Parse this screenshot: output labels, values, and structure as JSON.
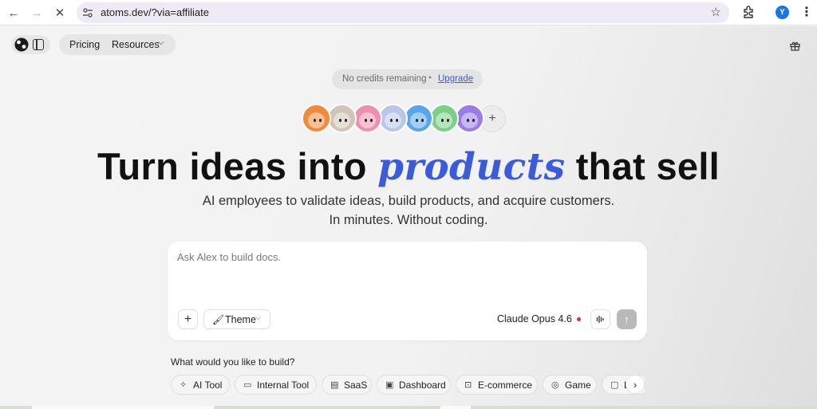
{
  "browser": {
    "url": "atoms.dev/?via=affiliate",
    "profile_initial": "Y",
    "back_icon": "←",
    "forward_icon": "→",
    "stop_icon": "✕",
    "star_icon": "☆",
    "menu_icon": "⋮"
  },
  "nav": {
    "pricing": "Pricing",
    "resources": "Resources",
    "chevron": "⌵"
  },
  "credits": {
    "message": "No credits remaining",
    "separator": "•",
    "upgrade": "Upgrade"
  },
  "avatars": {
    "colors": [
      "#f08a3c",
      "#cfc6b6",
      "#ef8fb0",
      "#b9c6e8",
      "#5aa4ec",
      "#7ccf84",
      "#9a7ce6"
    ],
    "plus": "+"
  },
  "hero": {
    "part1": "Turn ideas into ",
    "accent": "products",
    "part2": " that sell"
  },
  "subtitle": {
    "line1": "AI employees to validate ideas, build products, and acquire customers.",
    "line2": "In minutes. Without coding."
  },
  "composer": {
    "placeholder": "Ask Alex to build docs.",
    "add_label": "+",
    "theme_label": "Theme",
    "theme_icon": "🖌",
    "model": "Claude Opus 4.6",
    "send_icon": "↑"
  },
  "build": {
    "question": "What would you like to build?",
    "chips": [
      {
        "label": "AI Tool",
        "icon": "✧"
      },
      {
        "label": "Internal Tool",
        "icon": "▭"
      },
      {
        "label": "SaaS",
        "icon": "▤"
      },
      {
        "label": "Dashboard",
        "icon": "▣"
      },
      {
        "label": "E-commerce",
        "icon": "⊡"
      },
      {
        "label": "Game",
        "icon": "◎"
      },
      {
        "label": "L",
        "icon": "▢"
      }
    ],
    "next": "›"
  },
  "colors": {
    "accent": "#3b5bdb",
    "status_dot": "#e03131"
  }
}
